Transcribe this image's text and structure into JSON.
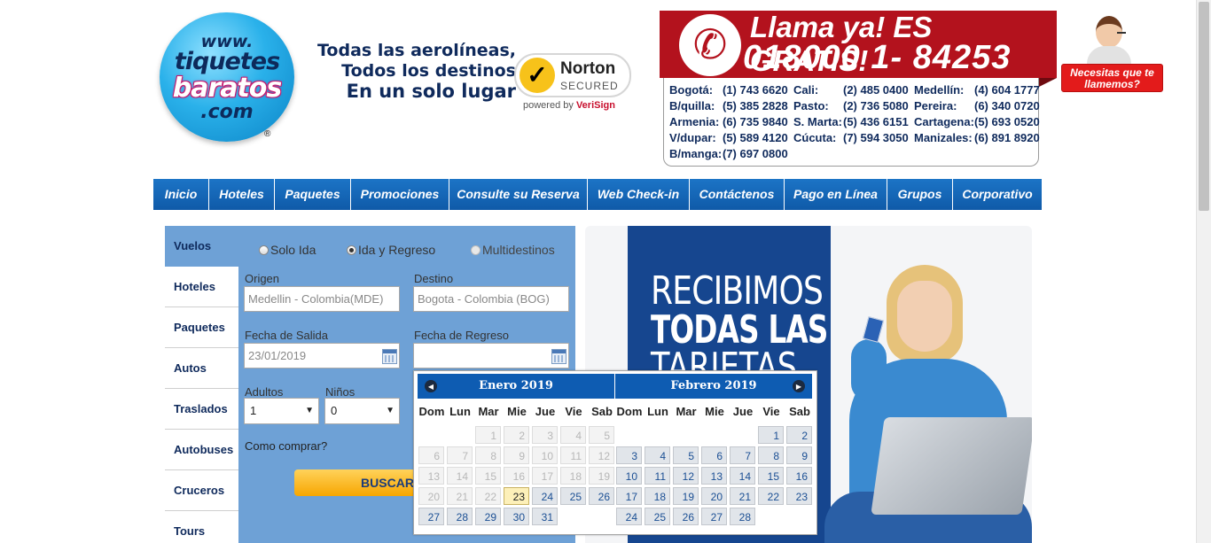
{
  "logo": {
    "line1": "www.",
    "line2": "tiquetes",
    "line3": "baratos",
    "line4": ".com",
    "reg": "®"
  },
  "tagline": {
    "line1": "Todas las aerolíneas,",
    "line2": "Todos los destinos",
    "line3": "En un solo lugar"
  },
  "norton": {
    "name": "Norton",
    "secured": "SECURED",
    "powered": "powered by",
    "brand": "VeriSign"
  },
  "hotline": {
    "title": "Llama ya! ES GRATIS!",
    "number": "018000 1- 84253",
    "phones": [
      [
        {
          "city": "Bogotá:",
          "num": "(1) 743 6620"
        },
        {
          "city": "Cali:",
          "num": "(2) 485 0400"
        },
        {
          "city": "Medellín:",
          "num": "(4) 604 1777"
        }
      ],
      [
        {
          "city": "B/quilla:",
          "num": "(5) 385 2828"
        },
        {
          "city": "Pasto:",
          "num": "(2) 736 5080"
        },
        {
          "city": "Pereira:",
          "num": "(6) 340 0720"
        }
      ],
      [
        {
          "city": "Armenia:",
          "num": "(6) 735 9840"
        },
        {
          "city": "S. Marta:",
          "num": "(5) 436 6151"
        },
        {
          "city": "Cartagena:",
          "num": "(5) 693 0520"
        }
      ],
      [
        {
          "city": "V/dupar:",
          "num": "(5) 589 4120"
        },
        {
          "city": "Cúcuta:",
          "num": "(7) 594 3050"
        },
        {
          "city": "Manizales:",
          "num": "(6) 891 8920"
        }
      ],
      [
        {
          "city": "B/manga:",
          "num": "(7) 697 0800"
        }
      ]
    ],
    "call_me": "Necesitas que te llamemos?"
  },
  "nav": [
    "Inicio",
    "Hoteles",
    "Paquetes",
    "Promociones",
    "Consulte su Reserva",
    "Web Check-in",
    "Contáctenos",
    "Pago en Línea",
    "Grupos",
    "Corporativo"
  ],
  "sidebar": [
    "Vuelos",
    "Hoteles",
    "Paquetes",
    "Autos",
    "Traslados",
    "Autobuses",
    "Cruceros",
    "Tours"
  ],
  "search": {
    "trip_types": [
      {
        "label": "Solo Ida",
        "selected": false,
        "disabled": false
      },
      {
        "label": "Ida y Regreso",
        "selected": true,
        "disabled": false
      },
      {
        "label": "Multidestinos",
        "selected": false,
        "disabled": true
      }
    ],
    "origin_label": "Origen",
    "origin_value": "Medellin - Colombia(MDE)",
    "destination_label": "Destino",
    "destination_value": "Bogota - Colombia (BOG)",
    "departure_label": "Fecha de Salida",
    "departure_value": "23/01/2019",
    "return_label": "Fecha de Regreso",
    "return_value": "",
    "adults_label": "Adultos",
    "adults_value": "1",
    "children_label": "Niños",
    "children_value": "0",
    "how_to_buy": "Como comprar?",
    "search_button": "BUSCAR"
  },
  "banner": {
    "line1": "RECIBIMOS",
    "line2": "TODAS LAS",
    "line3": "TARJETAS"
  },
  "datepicker": {
    "weekdays": [
      "Dom",
      "Lun",
      "Mar",
      "Mie",
      "Jue",
      "Vie",
      "Sab"
    ],
    "months": [
      {
        "title": "Enero 2019",
        "first_weekday": 2,
        "days": 31,
        "today": 23,
        "disabled_before": 23
      },
      {
        "title": "Febrero 2019",
        "first_weekday": 5,
        "days": 28,
        "today": 0,
        "disabled_before": 0
      }
    ]
  }
}
